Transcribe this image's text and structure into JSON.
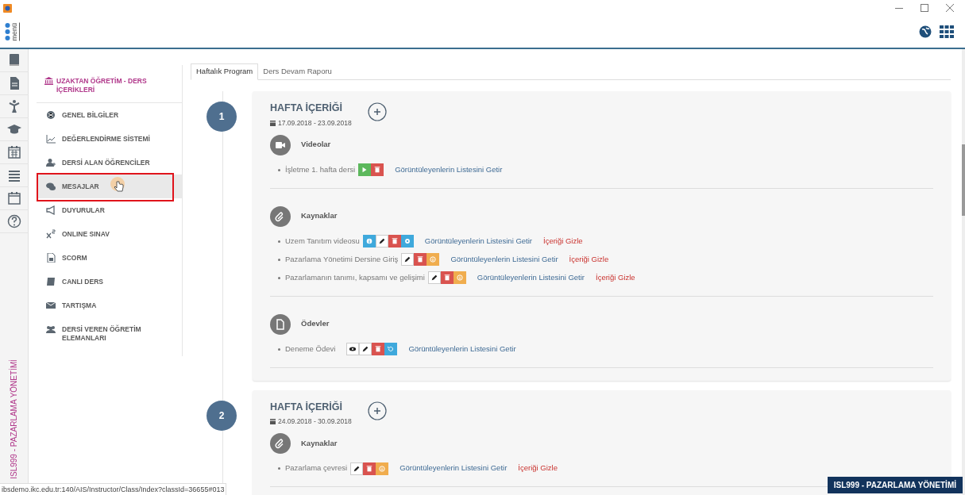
{
  "topbar": {
    "logo": "menü"
  },
  "rail": {
    "course_label": "ISL999 - PAZARLAMA YÖNETİMİ"
  },
  "sidebar": {
    "header": "UZAKTAN ÖĞRETİM - DERS İÇERİKLERİ",
    "items": [
      {
        "label": "GENEL BİLGİLER",
        "selected": false
      },
      {
        "label": "DEĞERLENDİRME SİSTEMİ",
        "selected": false
      },
      {
        "label": "DERSİ ALAN ÖĞRENCİLER",
        "selected": false
      },
      {
        "label": "MESAJLAR",
        "selected": true
      },
      {
        "label": "DUYURULAR",
        "selected": false
      },
      {
        "label": "ONLINE SINAV",
        "selected": false
      },
      {
        "label": "SCORM",
        "selected": false
      },
      {
        "label": "CANLI DERS",
        "selected": false
      },
      {
        "label": "TARTIŞMA",
        "selected": false
      },
      {
        "label": "DERSİ VEREN ÖĞRETİM ELEMANLARI",
        "selected": false
      }
    ]
  },
  "tabs": [
    {
      "label": "Haftalık Program",
      "selected": true
    },
    {
      "label": "Ders Devam Raporu",
      "selected": false
    }
  ],
  "weeks": [
    {
      "number": "1",
      "title": "HAFTA İÇERİĞİ",
      "dates": "17.09.2018 - 23.09.2018",
      "sections": [
        {
          "kind": "video",
          "title": "Videolar",
          "items": [
            {
              "label": "İşletme 1. hafta dersi",
              "actions": [
                {
                  "kind": "play"
                },
                {
                  "kind": "delete"
                }
              ],
              "viewers_link": "Görüntüleyenlerin Listesini Getir"
            }
          ]
        },
        {
          "kind": "resource",
          "title": "Kaynaklar",
          "items": [
            {
              "label": "Uzem Tanıtım videosu",
              "actions": [
                {
                  "kind": "info"
                },
                {
                  "kind": "edit"
                },
                {
                  "kind": "delete"
                },
                {
                  "kind": "settings"
                }
              ],
              "viewers_link": "Görüntüleyenlerin Listesini Getir",
              "hide_link": "İçeriği Gizle"
            },
            {
              "label": "Pazarlama Yönetimi Dersine Giriş",
              "actions": [
                {
                  "kind": "edit"
                },
                {
                  "kind": "delete"
                },
                {
                  "kind": "download"
                }
              ],
              "viewers_link": "Görüntüleyenlerin Listesini Getir",
              "hide_link": "İçeriği Gizle"
            },
            {
              "label": "Pazarlamanın tanımı, kapsamı ve gelişimi",
              "actions": [
                {
                  "kind": "edit"
                },
                {
                  "kind": "delete"
                },
                {
                  "kind": "download"
                }
              ],
              "viewers_link": "Görüntüleyenlerin Listesini Getir",
              "hide_link": "İçeriği Gizle"
            }
          ]
        },
        {
          "kind": "assignment",
          "title": "Ödevler",
          "items": [
            {
              "label": "Deneme Ödevi",
              "actions": [
                {
                  "kind": "view"
                },
                {
                  "kind": "edit"
                },
                {
                  "kind": "delete"
                },
                {
                  "kind": "restore"
                }
              ],
              "viewers_link": "Görüntüleyenlerin Listesini Getir"
            }
          ]
        }
      ]
    },
    {
      "number": "2",
      "title": "HAFTA İÇERİĞİ",
      "dates": "24.09.2018 - 30.09.2018",
      "sections": [
        {
          "kind": "resource",
          "title": "Kaynaklar",
          "items": [
            {
              "label": "Pazarlama çevresi",
              "actions": [
                {
                  "kind": "edit"
                },
                {
                  "kind": "delete"
                },
                {
                  "kind": "download"
                }
              ],
              "viewers_link": "Görüntüleyenlerin Listesini Getir",
              "hide_link": "İçeriği Gizle"
            }
          ]
        }
      ]
    }
  ],
  "status_bar": {
    "url": "ibsdemo.ikc.edu.tr:140/AIS/Instructor/Class/Index?classId=36655#013"
  },
  "course_badge": "ISL999 - PAZARLAMA YÖNETİMİ"
}
